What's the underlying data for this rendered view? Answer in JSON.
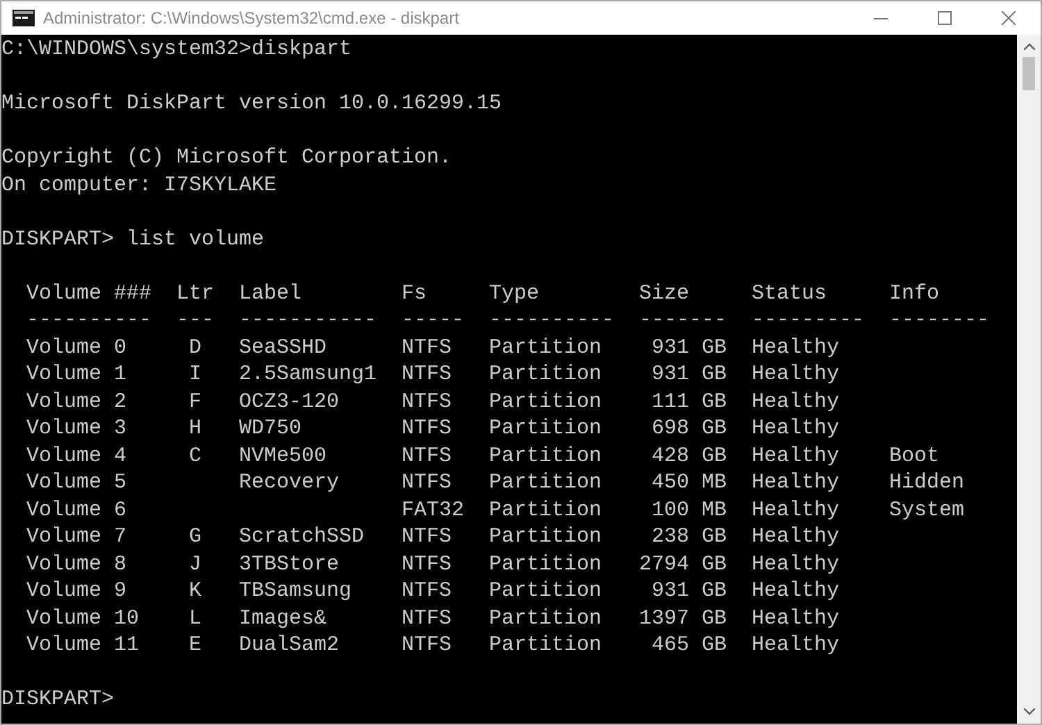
{
  "window": {
    "title": "Administrator: C:\\Windows\\System32\\cmd.exe - diskpart"
  },
  "console": {
    "prompt_1": "C:\\WINDOWS\\system32>diskpart",
    "version": "Microsoft DiskPart version 10.0.16299.15",
    "copyright": "Copyright (C) Microsoft Corporation.",
    "computer": "On computer: I7SKYLAKE",
    "command": "DISKPART> list volume",
    "table": {
      "columns": [
        {
          "header": "Volume ###",
          "rule": "----------"
        },
        {
          "header": "Ltr",
          "rule": "---"
        },
        {
          "header": "Label",
          "rule": "-----------"
        },
        {
          "header": "Fs",
          "rule": "-----"
        },
        {
          "header": "Type",
          "rule": "----------"
        },
        {
          "header": "Size",
          "rule": "-------"
        },
        {
          "header": "Status",
          "rule": "---------"
        },
        {
          "header": "Info",
          "rule": "--------"
        }
      ],
      "rows": [
        {
          "volume": "Volume 0",
          "ltr": "D",
          "label": "SeaSSHD",
          "fs": "NTFS",
          "type": "Partition",
          "size": "931 GB",
          "status": "Healthy"
        },
        {
          "volume": "Volume 1",
          "ltr": "I",
          "label": "2.5Samsung1",
          "fs": "NTFS",
          "type": "Partition",
          "size": "931 GB",
          "status": "Healthy"
        },
        {
          "volume": "Volume 2",
          "ltr": "F",
          "label": "OCZ3-120",
          "fs": "NTFS",
          "type": "Partition",
          "size": "111 GB",
          "status": "Healthy"
        },
        {
          "volume": "Volume 3",
          "ltr": "H",
          "label": "WD750",
          "fs": "NTFS",
          "type": "Partition",
          "size": "698 GB",
          "status": "Healthy"
        },
        {
          "volume": "Volume 4",
          "ltr": "C",
          "label": "NVMe500",
          "fs": "NTFS",
          "type": "Partition",
          "size": "428 GB",
          "status": "Healthy",
          "info": "Boot"
        },
        {
          "volume": "Volume 5",
          "label": "Recovery",
          "fs": "NTFS",
          "type": "Partition",
          "size": "450 MB",
          "status": "Healthy",
          "info": "Hidden"
        },
        {
          "volume": "Volume 6",
          "fs": "FAT32",
          "type": "Partition",
          "size": "100 MB",
          "status": "Healthy",
          "info": "System"
        },
        {
          "volume": "Volume 7",
          "ltr": "G",
          "label": "ScratchSSD",
          "fs": "NTFS",
          "type": "Partition",
          "size": "238 GB",
          "status": "Healthy"
        },
        {
          "volume": "Volume 8",
          "ltr": "J",
          "label": "3TBStore",
          "fs": "NTFS",
          "type": "Partition",
          "size": "2794 GB",
          "status": "Healthy"
        },
        {
          "volume": "Volume 9",
          "ltr": "K",
          "label": "TBSamsung",
          "fs": "NTFS",
          "type": "Partition",
          "size": "931 GB",
          "status": "Healthy"
        },
        {
          "volume": "Volume 10",
          "ltr": "L",
          "label": "Images&",
          "fs": "NTFS",
          "type": "Partition",
          "size": "1397 GB",
          "status": "Healthy"
        },
        {
          "volume": "Volume 11",
          "ltr": "E",
          "label": "DualSam2",
          "fs": "NTFS",
          "type": "Partition",
          "size": "465 GB",
          "status": "Healthy"
        }
      ]
    },
    "prompt_2": "DISKPART>"
  }
}
